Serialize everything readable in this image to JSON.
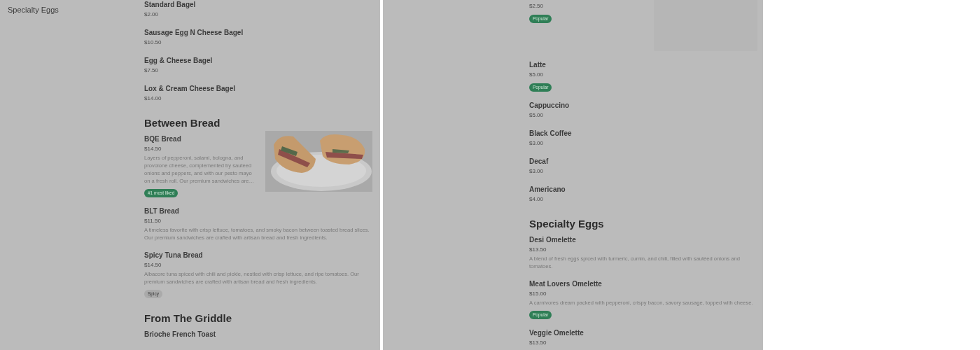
{
  "panels": [
    {
      "sidebar": {
        "items": [
          {
            "label": "Specialty Eggs"
          }
        ]
      },
      "sections": [
        {
          "items": [
            {
              "name": "Standard Bagel",
              "price": "$2.00"
            },
            {
              "name": "Sausage Egg N Cheese Bagel",
              "price": "$10.50"
            },
            {
              "name": "Egg & Cheese Bagel",
              "price": "$7.50"
            },
            {
              "name": "Lox & Cream Cheese Bagel",
              "price": "$14.00"
            }
          ]
        },
        {
          "title": "Between Bread",
          "items": [
            {
              "name": "BQE Bread",
              "price": "$14.50",
              "description": "Layers of pepperoni, salami, bologna, and provolone cheese, complemented by sauteed onions and peppers, and with our pesto mayo on a fresh roll. Our premium sandwiches are…",
              "badges": [
                {
                  "label": "#1 most liked",
                  "kind": "highlight"
                }
              ],
              "media": {
                "kind": "picture"
              }
            },
            {
              "name": "BLT Bread",
              "price": "$11.50",
              "description": "A timeless favorite with crisp lettuce, tomatoes, and smoky bacon between toasted bread slices. Our premium sandwiches are crafted with artisan bread and fresh ingredients."
            },
            {
              "name": "Spicy Tuna Bread",
              "price": "$14.50",
              "description": "Albacore tuna spiced with chili and pickle, nestled with crisp lettuce, and ripe tomatoes. Our premium sandwiches are crafted with artisan bread and fresh ingredients.",
              "badges": [
                {
                  "label": "Spicy",
                  "kind": "tag"
                }
              ]
            }
          ]
        },
        {
          "title": "From The Griddle",
          "items": [
            {
              "name": "Brioche French Toast"
            }
          ]
        }
      ]
    },
    {
      "sections": [
        {
          "items": [
            {
              "price": "$2.50",
              "badges": [
                {
                  "label": "Popular",
                  "kind": "highlight"
                }
              ],
              "media": {
                "kind": "placeholder"
              }
            },
            {
              "name": "Latte",
              "price": "$5.00",
              "badges": [
                {
                  "label": "Popular",
                  "kind": "highlight"
                }
              ]
            },
            {
              "name": "Cappuccino",
              "price": "$5.00"
            },
            {
              "name": "Black Coffee",
              "price": "$3.00"
            },
            {
              "name": "Decaf",
              "price": "$3.00"
            },
            {
              "name": "Americano",
              "price": "$4.00"
            }
          ]
        },
        {
          "title": "Specialty Eggs",
          "items": [
            {
              "name": "Desi Omelette",
              "price": "$13.50",
              "description": "A blend of fresh eggs spiced with turmeric, cumin, and chili, filled with sautéed onions and tomatoes."
            },
            {
              "name": "Meat Lovers Omelette",
              "price": "$15.00",
              "description": "A carnivores dream packed with pepperoni, crispy bacon, savory sausage, topped with cheese.",
              "badges": [
                {
                  "label": "Popular",
                  "kind": "highlight"
                }
              ]
            },
            {
              "name": "Veggie Omelette",
              "price": "$13.50"
            }
          ]
        }
      ]
    }
  ]
}
